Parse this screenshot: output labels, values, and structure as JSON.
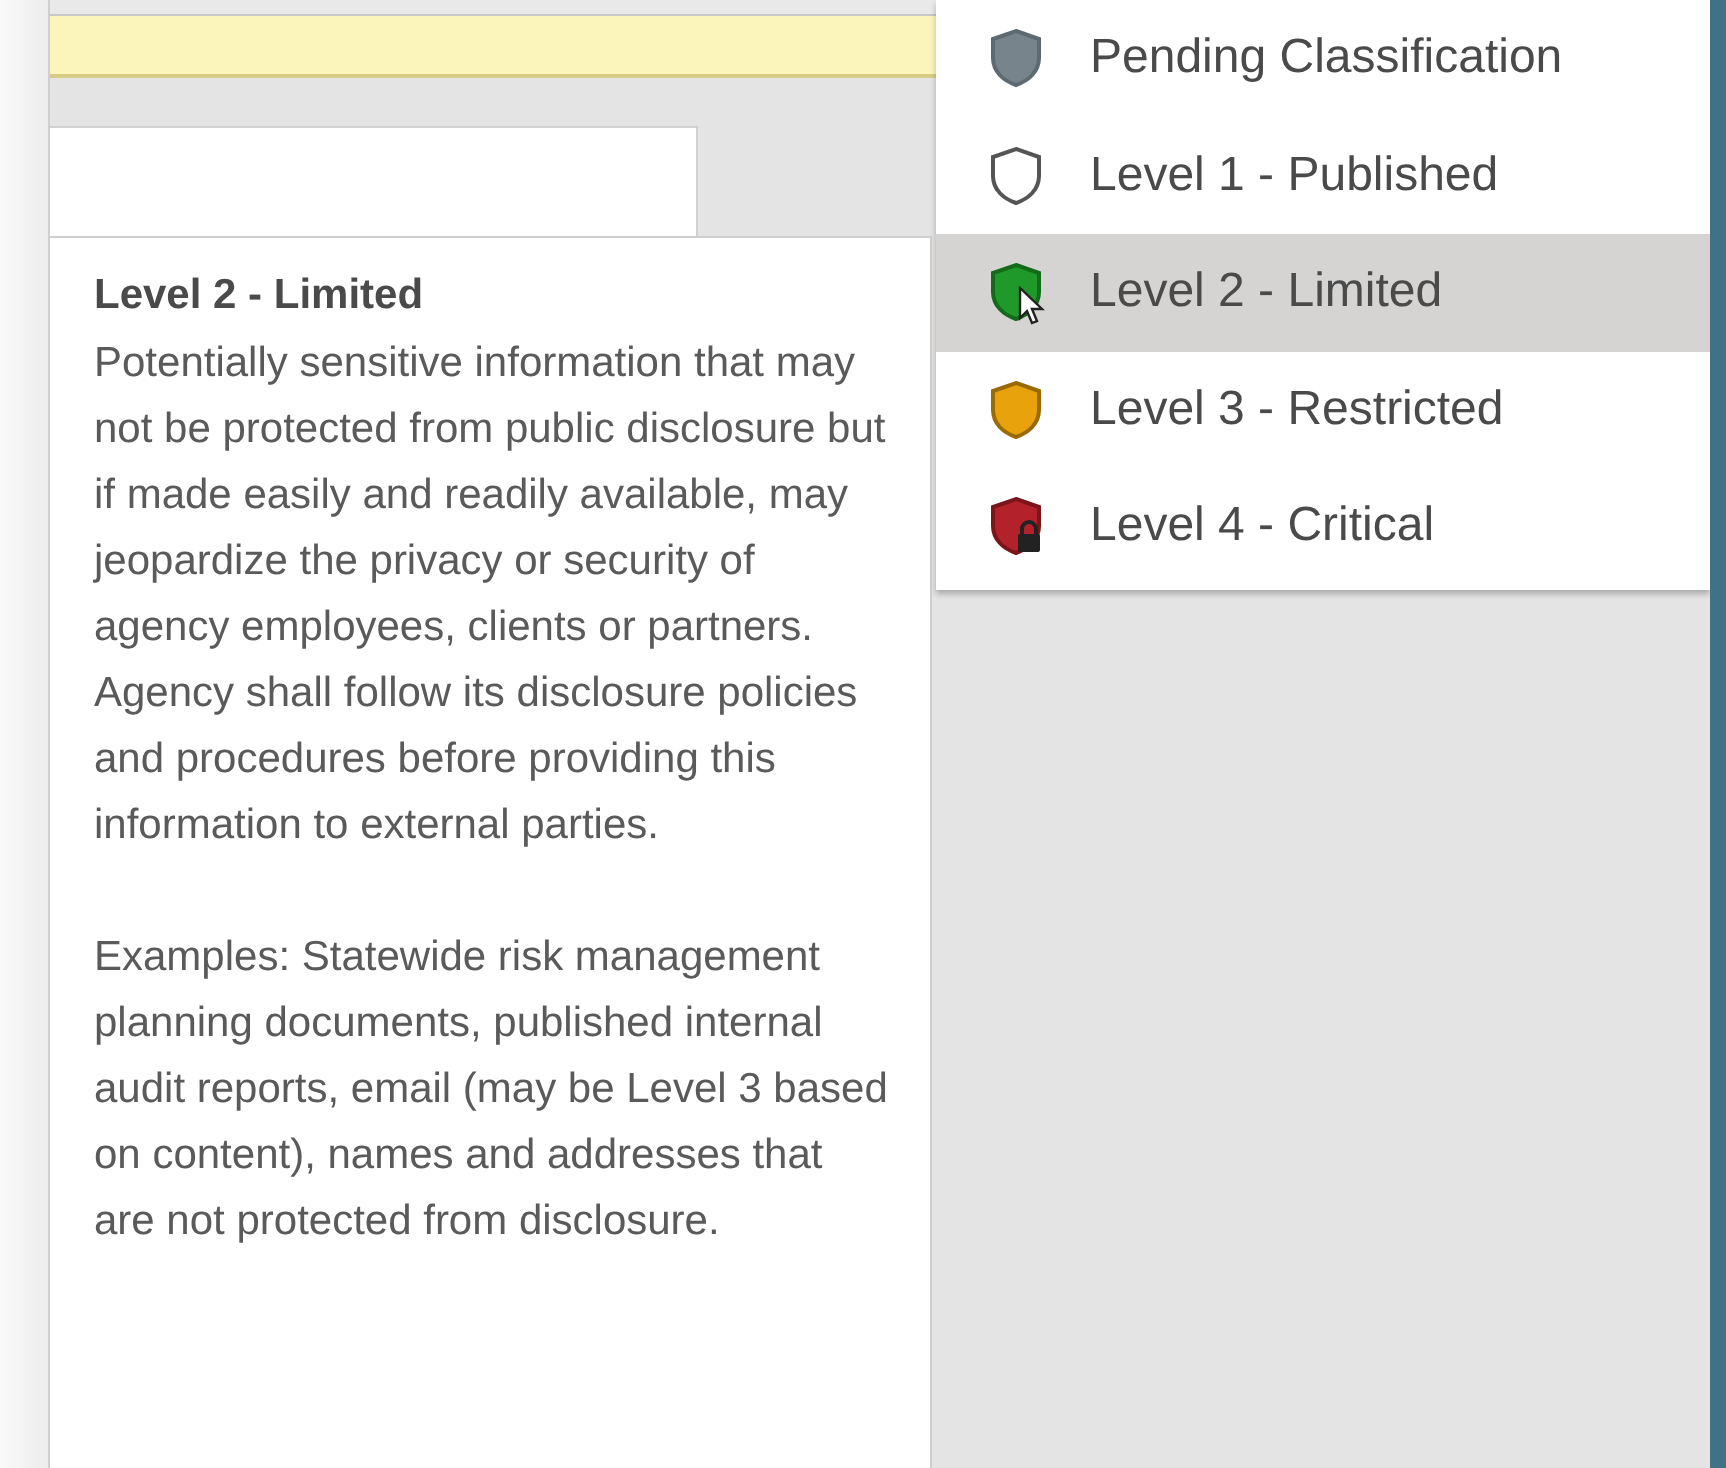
{
  "menu": {
    "items": [
      {
        "label": "Pending Classification",
        "kind": "pending",
        "selected": false
      },
      {
        "label": "Level 1 - Published",
        "kind": "published",
        "selected": false
      },
      {
        "label": "Level 2 - Limited",
        "kind": "limited",
        "selected": true
      },
      {
        "label": "Level 3 - Restricted",
        "kind": "restricted",
        "selected": false
      },
      {
        "label": "Level 4 - Critical",
        "kind": "critical",
        "selected": false
      }
    ]
  },
  "tooltip": {
    "title": "Level 2 - Limited",
    "paragraphs": [
      "Potentially sensitive information that may not be protected from public disclosure but if made easily and readily available, may jeopardize the privacy or security of agency employees, clients or partners. Agency shall follow its disclosure policies and procedures before providing this information to external parties.",
      "Examples: Statewide risk management planning documents, published internal audit reports, email (may be Level 3 based on content), names and addresses that are not protected from disclosure."
    ]
  }
}
